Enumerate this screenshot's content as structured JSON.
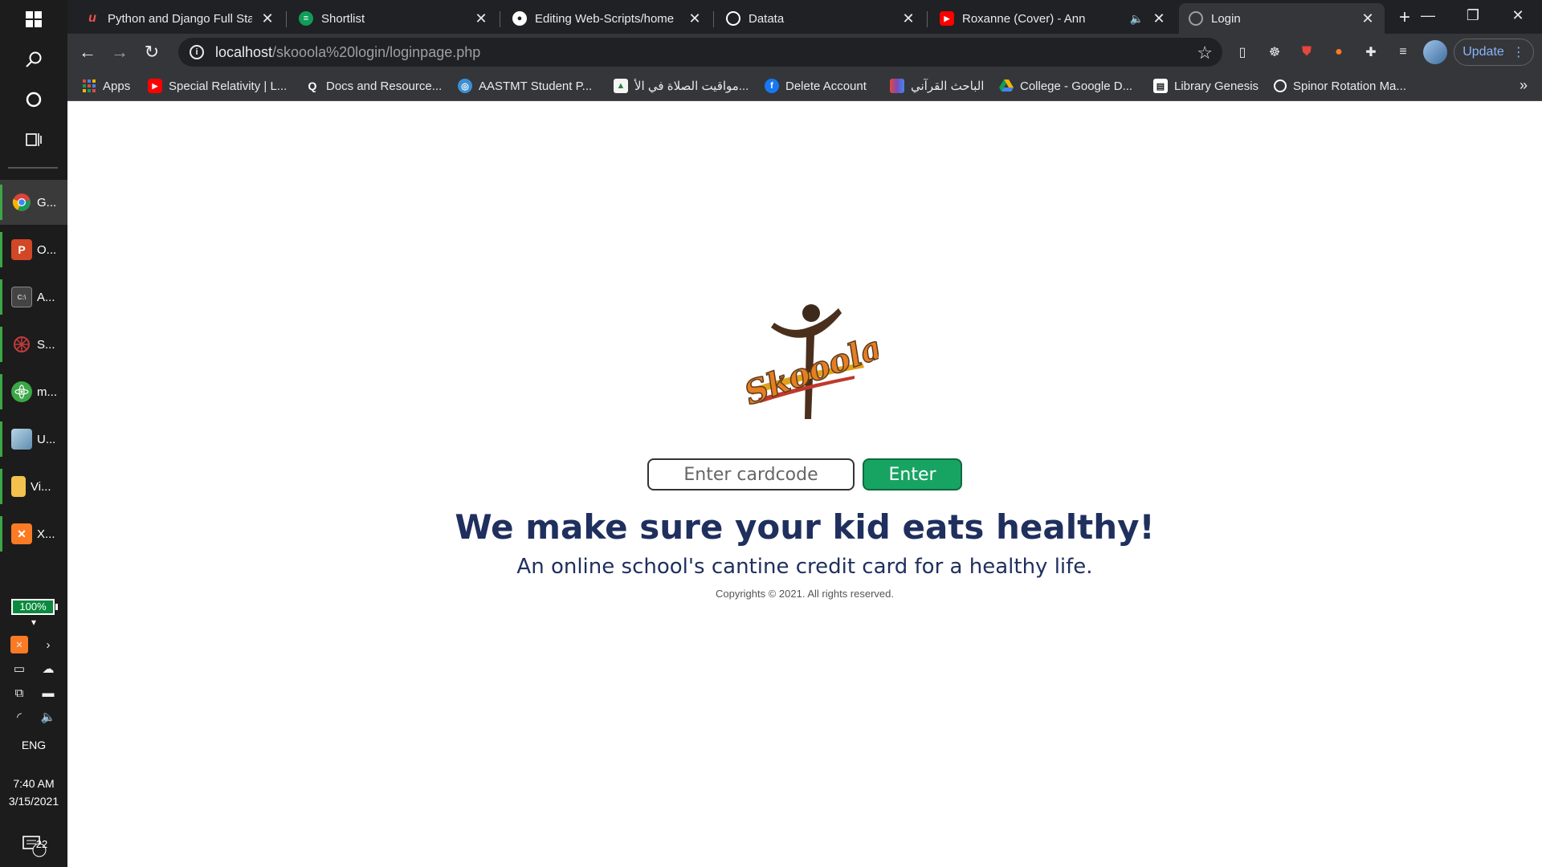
{
  "taskbar": {
    "apps": [
      {
        "label": "G...",
        "icon": "chrome-icon",
        "color": "#e8453c"
      },
      {
        "label": "O...",
        "icon": "powerpoint-icon",
        "color": "#d24726"
      },
      {
        "label": "A...",
        "icon": "terminal-icon",
        "color": "#444444"
      },
      {
        "label": "S...",
        "icon": "spider-icon",
        "color": "#c23b3b"
      },
      {
        "label": "m...",
        "icon": "atom-icon",
        "color": "#3ba745"
      },
      {
        "label": "U...",
        "icon": "cube-icon",
        "color": "#7aa7c7"
      },
      {
        "label": "Vi...",
        "icon": "folder-icon",
        "color": "#f2c14e"
      },
      {
        "label": "X...",
        "icon": "xampp-icon",
        "color": "#fb7a24"
      }
    ],
    "battery": "100%",
    "language": "ENG",
    "time": "7:40 AM",
    "date": "3/15/2021",
    "notifications": "22"
  },
  "tabs": [
    {
      "title": "Python and Django Full Sta",
      "favicon": "udemy-icon",
      "color": "#ec5252"
    },
    {
      "title": "Shortlist",
      "favicon": "sheets-icon",
      "color": "#0f9d58"
    },
    {
      "title": "Editing Web-Scripts/home",
      "favicon": "github-icon",
      "color": "#ffffff"
    },
    {
      "title": "Datata",
      "favicon": "globe-icon",
      "color": "#ffffff"
    },
    {
      "title": "Roxanne (Cover) - Ann",
      "favicon": "youtube-icon",
      "color": "#ff0000"
    },
    {
      "title": "Login",
      "favicon": "globe-icon",
      "color": "#9aa0a6"
    }
  ],
  "address_bar": {
    "host": "localhost",
    "path": "/skooola%20login/loginpage.php"
  },
  "toolbar": {
    "update_label": "Update"
  },
  "bookmarks": [
    {
      "label": "Apps",
      "icon": "apps-grid-icon",
      "color": "#e8453c"
    },
    {
      "label": "Special Relativity | L...",
      "icon": "youtube-icon",
      "color": "#ff0000"
    },
    {
      "label": "Docs and Resource...",
      "icon": "q-icon",
      "color": "#35363a"
    },
    {
      "label": "AASTMT Student P...",
      "icon": "aastmt-icon",
      "color": "#3b8fd4"
    },
    {
      "label": "مواقيت الصلاة في الأ...",
      "icon": "mosque-icon",
      "color": "#f4f4f4"
    },
    {
      "label": "Delete Account",
      "icon": "facebook-icon",
      "color": "#1877f2"
    },
    {
      "label": "الباحث القرآني",
      "icon": "book-icon",
      "color": "#7b4bb7"
    },
    {
      "label": "College - Google D...",
      "icon": "drive-icon",
      "color": "#f4b400"
    },
    {
      "label": "Library Genesis",
      "icon": "library-icon",
      "color": "#ffffff"
    },
    {
      "label": "Spinor Rotation Ma...",
      "icon": "globe-icon",
      "color": "#ffffff"
    }
  ],
  "page": {
    "logo_text": "Skooola",
    "card_placeholder": "Enter cardcode",
    "enter_label": "Enter",
    "headline": "We make sure your kid eats healthy!",
    "subline": "An online school's cantine credit card for a healthy life.",
    "copyright": "Copyrights © 2021. All rights reserved."
  },
  "colors": {
    "headline": "#1f2f5e",
    "enter_button": "#17a463",
    "chrome_dark": "#202124",
    "chrome_toolbar": "#35363a"
  }
}
